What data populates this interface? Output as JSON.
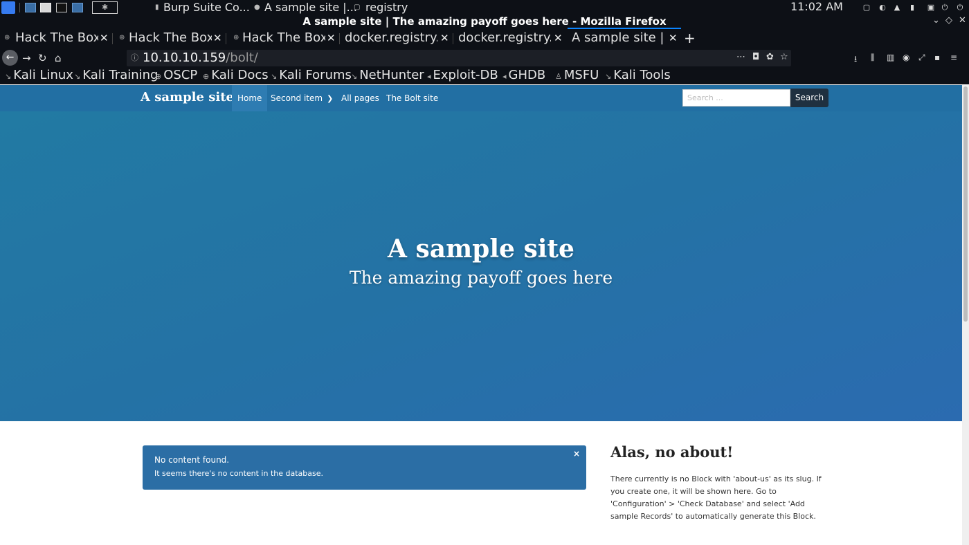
{
  "panel": {
    "tasks": [
      "Burp Suite Co...",
      "A sample site |...",
      "registry"
    ],
    "clock": "11:02 AM"
  },
  "window": {
    "title": "A sample site | The amazing payoff goes here - Mozilla Firefox"
  },
  "tabs": [
    {
      "label": "Hack The Box :",
      "active": false
    },
    {
      "label": "Hack The Box :",
      "active": false
    },
    {
      "label": "Hack The Box :",
      "active": false
    },
    {
      "label": "docker.registry.ht",
      "active": false
    },
    {
      "label": "docker.registry.ht",
      "active": false
    },
    {
      "label": "A sample site | Th",
      "active": true
    }
  ],
  "url": {
    "host": "10.10.10.159",
    "path": "/bolt/"
  },
  "bookmarks": [
    "Kali Linux",
    "Kali Training",
    "OSCP",
    "Kali Docs",
    "Kali Forums",
    "NetHunter",
    "Exploit-DB",
    "GHDB",
    "MSFU",
    "Kali Tools"
  ],
  "site": {
    "brand": "A sample site",
    "nav": [
      "Home",
      "Second item",
      "All pages",
      "The Bolt site"
    ],
    "search_placeholder": "Search ...",
    "search_button": "Search"
  },
  "hero": {
    "title": "A sample site",
    "subtitle": "The amazing payoff goes here"
  },
  "alert": {
    "title": "No content found.",
    "message": "It seems there's no content in the database.",
    "close": "×"
  },
  "about": {
    "title": "Alas, no about!",
    "text": "There currently is no Block with 'about-us' as its slug. If you create one, it will be shown here. Go to 'Configuration' > 'Check Database' and select 'Add sample Records' to automatically generate this Block."
  },
  "colors": {
    "site_nav": "#226fa3",
    "hero": "#2472a5",
    "alert": "#2b6ea5",
    "active_tab_accent": "#0a84ff"
  }
}
